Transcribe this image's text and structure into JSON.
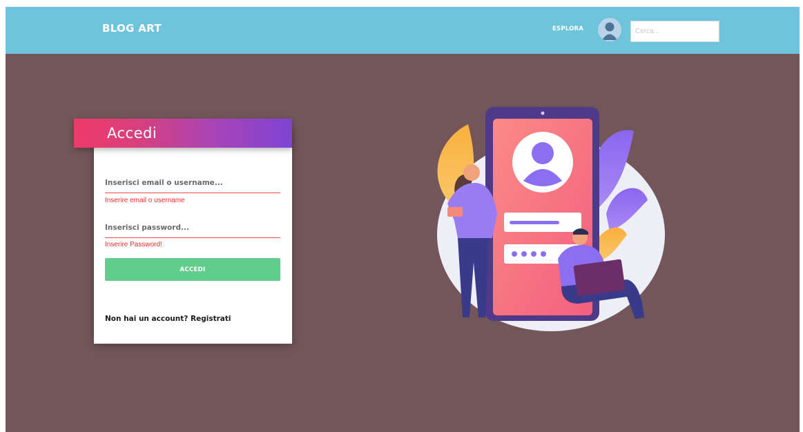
{
  "navbar": {
    "brand": "BLOG ART",
    "explore_label": "ESPLORA",
    "search_placeholder": "Cerca..."
  },
  "login": {
    "title": "Accedi",
    "user_placeholder": "Inserisci email o username...",
    "user_error": "Inserire email o username",
    "password_placeholder": "Inserisci password...",
    "password_error": "Inserire Password!",
    "submit_label": "ACCEDI",
    "signup_prompt": "Non hai un account?",
    "signup_link": "Registrati"
  },
  "colors": {
    "navbar": "#6ec4dd",
    "background": "#73565a",
    "header_gradient_start": "#ee3a6a",
    "header_gradient_end": "#7e44d4",
    "button": "#61cd8c",
    "error": "#f02b2b"
  },
  "icons": {
    "avatar": "user-avatar-icon"
  }
}
